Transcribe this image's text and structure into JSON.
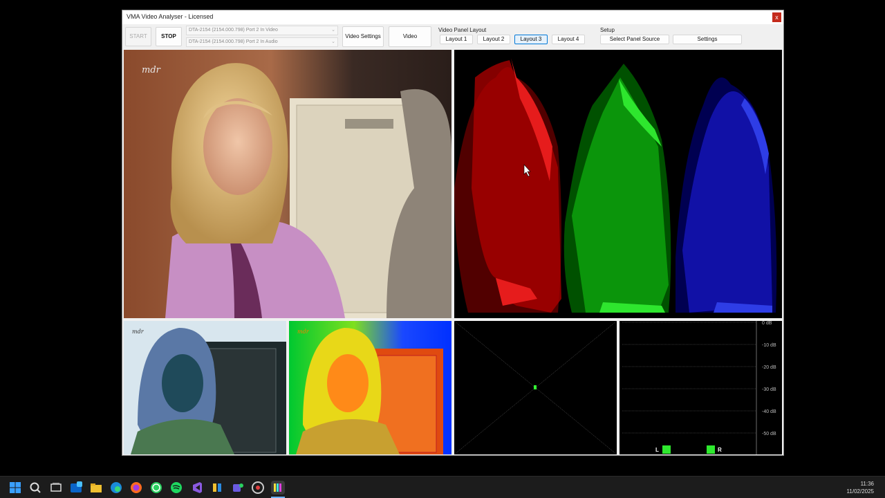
{
  "window": {
    "title": "VMA Video Analyser - Licensed",
    "close_glyph": "x"
  },
  "toolbar": {
    "start_label": "START",
    "stop_label": "STOP",
    "video_input": "DTA-2154 (2154.000.798) Port 2 In Video",
    "audio_input": "DTA-2154 (2154.000.798) Port 2 In Audio",
    "video_settings_label": "Video Settings",
    "video_resolution_label": "Video Resolution"
  },
  "layout_group": {
    "label": "Video Panel Layout",
    "buttons": [
      "Layout 1",
      "Layout 2",
      "Layout 3",
      "Layout 4"
    ],
    "selected": "Layout 3"
  },
  "setup_group": {
    "label": "Setup",
    "select_source_label": "Select Panel Source",
    "settings_label": "Settings"
  },
  "panels": {
    "channel_logo": "mdr",
    "audio_meter": {
      "scale": [
        "0 dB",
        "-10 dB",
        "-20 dB",
        "-30 dB",
        "-40 dB",
        "-50 dB"
      ],
      "left_label": "L",
      "right_label": "R",
      "level_color": "#2ee82e"
    }
  },
  "colors": {
    "accent": "#0078d7",
    "close": "#c42b1c",
    "waveform_red": "#ff1a1a",
    "waveform_green": "#22ff22",
    "waveform_blue": "#2233ff"
  },
  "taskbar": {
    "time": "11:36",
    "date": "11/02/2025",
    "icons": [
      "windows-start-icon",
      "search-icon",
      "task-view-icon",
      "outlook-icon",
      "file-explorer-icon",
      "edge-icon",
      "firefox-icon",
      "whatsapp-icon",
      "spotify-icon",
      "visual-studio-icon",
      "app-icon",
      "teams-icon",
      "chrome-icon",
      "vma-analyser-icon"
    ]
  }
}
